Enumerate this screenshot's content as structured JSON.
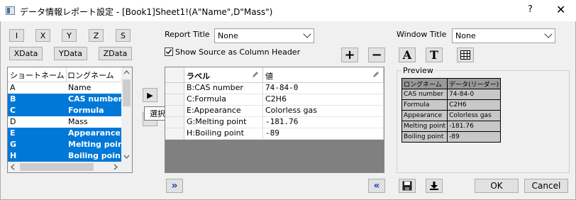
{
  "window": {
    "title": "データ情報レポート設定 - [Book1]Sheet1!(A\"Name\",D\"Mass\")",
    "help_glyph": "?",
    "close_glyph": "✕"
  },
  "columns_buttons": [
    "I",
    "X",
    "Y",
    "Z",
    "S"
  ],
  "data_buttons": [
    "XData",
    "YData",
    "ZData"
  ],
  "report_title": {
    "label": "Report Title",
    "value": "None"
  },
  "window_title": {
    "label": "Window Title",
    "value": "None"
  },
  "show_source": {
    "label": "Show Source as Column Header",
    "checked": true
  },
  "column_list": {
    "headers": [
      "ショートネーム",
      "ロングネーム"
    ],
    "rows": [
      {
        "short": "A",
        "long": "Name",
        "selected": false
      },
      {
        "short": "B",
        "long": "CAS number",
        "selected": true
      },
      {
        "short": "C",
        "long": "Formula",
        "selected": true
      },
      {
        "short": "D",
        "long": "Mass",
        "selected": false
      },
      {
        "short": "E",
        "long": "Appearance",
        "selected": true
      },
      {
        "short": "G",
        "long": "Melting poin",
        "selected": true
      },
      {
        "short": "H",
        "long": "Boiling poin",
        "selected": true
      }
    ]
  },
  "tooltip": "選択",
  "grid": {
    "headers": [
      "ラベル",
      "値"
    ],
    "rows": [
      [
        "B:CAS number",
        "74-84-0"
      ],
      [
        "C:Formula",
        "C2H6"
      ],
      [
        "E:Appearance",
        "Colorless gas"
      ],
      [
        "G:Melting point",
        "-181.76"
      ],
      [
        "H:Boiling point",
        "-89"
      ]
    ]
  },
  "preview": {
    "label": "Preview",
    "headers": [
      "ロングネーム",
      "データ(リーダー)"
    ],
    "rows": [
      [
        "CAS number",
        "74-84-0"
      ],
      [
        "Formula",
        "C2H6"
      ],
      [
        "Appearance",
        "Colorless gas"
      ],
      [
        "Melting point",
        "-181.76"
      ],
      [
        "Boiling point",
        "-89"
      ]
    ]
  },
  "toolbar": {
    "add_glyph": "+",
    "remove_glyph": "−",
    "font_glyph": "A",
    "text_glyph": "T",
    "table_icon": "table-icon"
  },
  "nav": {
    "expand_glyph": "»",
    "collapse_glyph": "«",
    "move_right_glyph": "▶"
  },
  "ok_label": "OK",
  "cancel_label": "Cancel"
}
